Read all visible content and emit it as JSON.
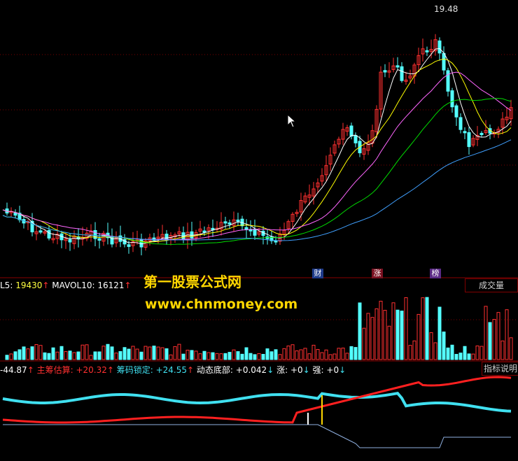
{
  "price_panel": {
    "high_label": "19.48",
    "tags": [
      {
        "text": "财",
        "color": "#1e3a8a"
      },
      {
        "text": "涨",
        "color": "#7a1020"
      },
      {
        "text": "榜",
        "color": "#5b2a86"
      }
    ]
  },
  "volume_panel": {
    "ma5_label": "L5: ",
    "ma5_value": "19430",
    "ma5_arrow": "↑",
    "ma10_label": "MAVOL10: ",
    "ma10_value": "16121",
    "ma10_arrow": "↑",
    "button": "成交量"
  },
  "indicator_panel": {
    "v0": "-44.87",
    "v0_arrow": "↑",
    "v1_label": "主筹估算: ",
    "v1_value": "+20.32",
    "v1_arrow": "↑",
    "v2_label": "筹码锁定: ",
    "v2_value": "+24.55",
    "v2_arrow": "↑",
    "v3_label": "动态底部: ",
    "v3_value": "+0.042",
    "v3_arrow": "↓",
    "v4_label": "涨: ",
    "v4_value": "+0",
    "v4_arrow": "↓",
    "v5_label": "强: ",
    "v5_value": "+0",
    "v5_arrow": "↓",
    "button": "指标说明"
  },
  "watermark": {
    "title": "第一股票公式网",
    "url": "www.chnmoney.com"
  },
  "colors": {
    "up": "#ff3030",
    "down": "#54ffff",
    "ma5": "#ffffff",
    "ma10": "#ffff00",
    "ma20": "#ff66ff",
    "ma30": "#00dd00",
    "ma60": "#40a0ff",
    "main": "#ff2020",
    "lock": "#40e0f0",
    "bottom": "#8fb0e0"
  }
}
